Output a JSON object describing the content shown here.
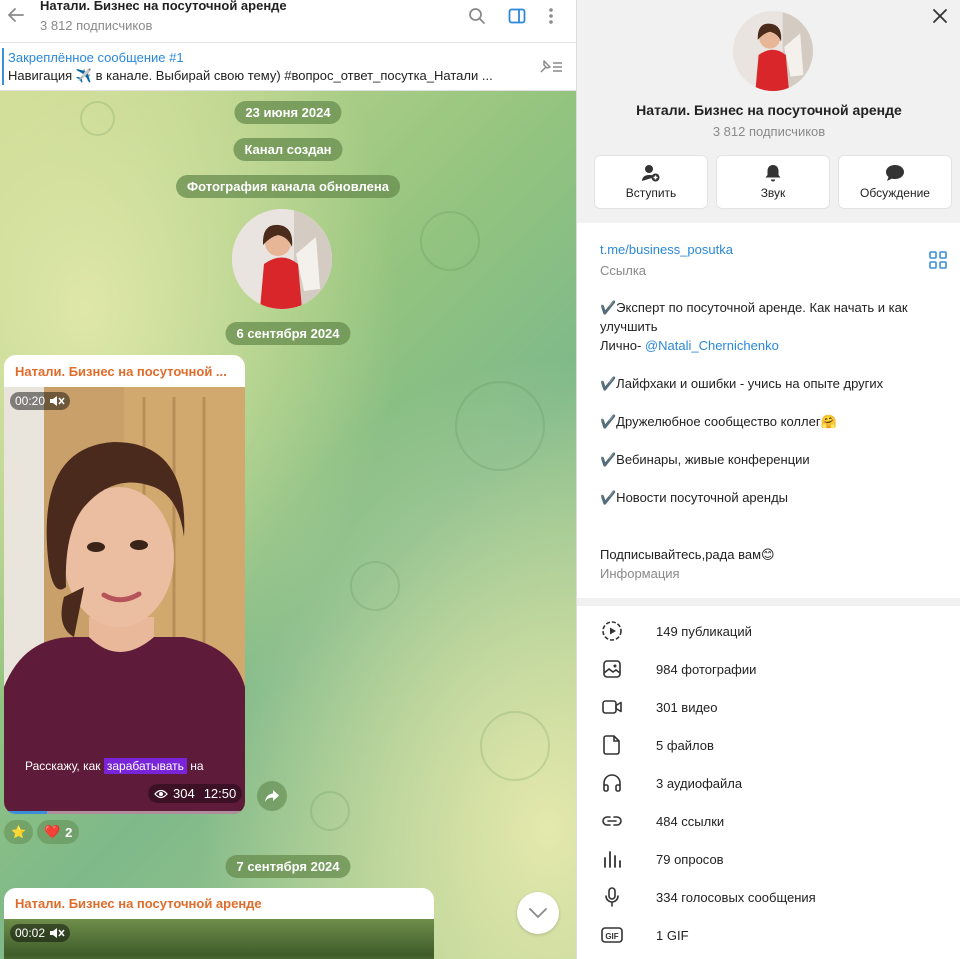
{
  "chat": {
    "title": "Натали. Бизнес на посуточной аренде",
    "subtitle": "3 812 подписчиков",
    "pinned": {
      "title": "Закреплённое сообщение #1",
      "text": "Навигация ✈️ в канале. Выбирай свою тему)  #вопрос_ответ_посутка_Натали ..."
    },
    "service": {
      "date1": "23 июня 2024",
      "created": "Канал создан",
      "photo_updated": "Фотография канала обновлена",
      "date2": "6 сентября 2024",
      "date3": "7 сентября 2024"
    },
    "message1": {
      "author": "Натали. Бизнес на посуточной ...",
      "duration": "00:20",
      "caption_before": "Расскажу, как ",
      "caption_highlight": "зарабатывать",
      "caption_after": " на",
      "views": "304",
      "time": "12:50",
      "progress": 0.18
    },
    "reactions": {
      "star": "⭐",
      "heart": "❤️",
      "heart_count": "2"
    },
    "message2": {
      "author": "Натали. Бизнес на посуточной аренде",
      "duration": "00:02"
    }
  },
  "profile": {
    "name": "Натали. Бизнес на посуточной аренде",
    "subtitle": "3 812 подписчиков",
    "actions": {
      "join": "Вступить",
      "sound": "Звук",
      "discussion": "Обсуждение"
    },
    "link": "t.me/business_posutka",
    "link_label": "Ссылка",
    "description": {
      "line1": "✔️Эксперт по посуточной аренде. Как начать и как улучшить",
      "line2_prefix": "Лично- ",
      "line2_mention": "@Natali_Chernichenko",
      "line3": "✔️Лайфхаки и ошибки - учись на опыте других",
      "line4": "✔️Дружелюбное сообщество коллег🤗",
      "line5": "✔️Вебинары, живые конференции",
      "line6": "✔️Новости посуточной аренды",
      "line7": "Подписывайтесь,рада вам😊"
    },
    "info_label": "Информация",
    "stats": [
      {
        "icon": "posts-icon",
        "label": "149 публикаций"
      },
      {
        "icon": "photo-icon",
        "label": "984 фотографии"
      },
      {
        "icon": "video-icon",
        "label": "301 видео"
      },
      {
        "icon": "file-icon",
        "label": "5 файлов"
      },
      {
        "icon": "headphones-icon",
        "label": "3 аудиофайла"
      },
      {
        "icon": "link-icon",
        "label": "484 ссылки"
      },
      {
        "icon": "poll-icon",
        "label": "79 опросов"
      },
      {
        "icon": "microphone-icon",
        "label": "334 голосовых сообщения"
      },
      {
        "icon": "gif-icon",
        "label": "1 GIF"
      }
    ]
  }
}
